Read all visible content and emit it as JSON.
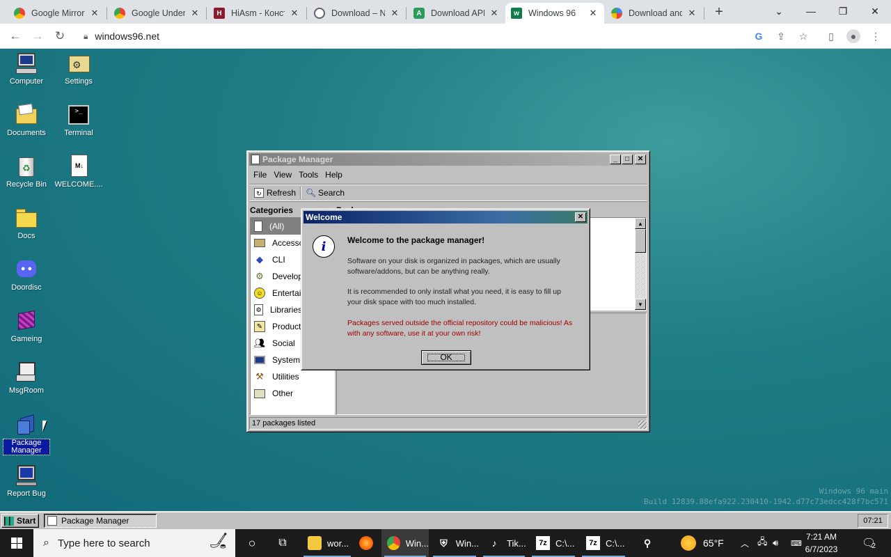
{
  "browser": {
    "tabs": [
      {
        "title": "Google Mirror",
        "icon": "chrome-icon",
        "color": "#e8453c"
      },
      {
        "title": "Google Underwater",
        "icon": "chrome-icon",
        "color": "#e8453c"
      },
      {
        "title": "HiAsm - Конструктор",
        "icon": "hiasm-icon",
        "color": "#8b1a2b"
      },
      {
        "title": "Download – N",
        "icon": "globe-icon",
        "color": "#5f6368"
      },
      {
        "title": "Download APK",
        "icon": "apk-icon",
        "color": "#2a9d5c"
      },
      {
        "title": "Windows 96",
        "icon": "win96-icon",
        "color": "#0f7a4a"
      },
      {
        "title": "Download and",
        "icon": "pinwheel-icon",
        "color": "#4285f4"
      }
    ],
    "new_tab": "+",
    "url": "windows96.net"
  },
  "desktop": {
    "icons": [
      {
        "label": "Computer",
        "icon": "computer-icon"
      },
      {
        "label": "Settings",
        "icon": "settings-icon"
      },
      {
        "label": "Documents",
        "icon": "documents-folder-icon"
      },
      {
        "label": "Terminal",
        "icon": "terminal-icon"
      },
      {
        "label": "Recycle Bin",
        "icon": "recycle-bin-icon"
      },
      {
        "label": "WELCOME....",
        "icon": "markdown-file-icon"
      },
      {
        "label": "Docs",
        "icon": "folder-icon"
      },
      {
        "label": "Doordisc",
        "icon": "discord-icon"
      },
      {
        "label": "Gameing",
        "icon": "game-cube-icon"
      },
      {
        "label": "MsgRoom",
        "icon": "msgroom-icon"
      },
      {
        "label": "Package Manager",
        "icon": "package-manager-icon"
      },
      {
        "label": "Report Bug",
        "icon": "report-bug-icon"
      }
    ],
    "watermark_line1": "Windows 96 main",
    "watermark_line2": "Build 12839.88efa922.230410-1942.d77c73edcc428f7bc571"
  },
  "package_manager": {
    "title": "Package Manager",
    "menu": [
      "File",
      "View",
      "Tools",
      "Help"
    ],
    "toolbar": {
      "refresh": "Refresh",
      "search": "Search"
    },
    "categories_header": "Categories",
    "packages_header": "Packages",
    "categories": [
      {
        "label": "(All)",
        "icon": "all-icon"
      },
      {
        "label": "Accessories",
        "icon": "accessories-icon"
      },
      {
        "label": "CLI",
        "icon": "cli-icon"
      },
      {
        "label": "Development",
        "icon": "development-icon"
      },
      {
        "label": "Entertainment",
        "icon": "entertainment-icon"
      },
      {
        "label": "Libraries",
        "icon": "libraries-icon"
      },
      {
        "label": "Productivity",
        "icon": "productivity-icon"
      },
      {
        "label": "Social",
        "icon": "social-icon"
      },
      {
        "label": "System",
        "icon": "system-icon"
      },
      {
        "label": "Utilities",
        "icon": "utilities-icon"
      },
      {
        "label": "Other",
        "icon": "other-icon"
      }
    ],
    "status": "17 packages listed"
  },
  "welcome_dialog": {
    "title": "Welcome",
    "heading": "Welcome to the package manager!",
    "p1": "Software on your disk is organized in packages, which are usually software/addons, but can be anything really.",
    "p2": "It is recommended to only install what you need, it is easy to fill up your disk space with too much installed.",
    "p3": "Packages served outside the official repository could be malicious! As with any software, use it at your own risk!",
    "ok": "OK"
  },
  "taskbar96": {
    "start": "Start",
    "task": "Package Manager",
    "clock": "07:21"
  },
  "taskbar10": {
    "search_placeholder": "Type here to search",
    "apps": [
      {
        "label": "wor...",
        "icon": "file-explorer-icon"
      },
      {
        "label": "",
        "icon": "firefox-icon"
      },
      {
        "label": "Win...",
        "icon": "chrome-icon"
      },
      {
        "label": "Win...",
        "icon": "shield-icon"
      },
      {
        "label": "Tik...",
        "icon": "tiktok-icon"
      },
      {
        "label": "C:\\...",
        "icon": "7zip-icon"
      },
      {
        "label": "C:\\...",
        "icon": "7zip-icon"
      }
    ],
    "weather": "65°F",
    "time": "7:21 AM",
    "date": "6/7/2023",
    "notifications": "2"
  }
}
